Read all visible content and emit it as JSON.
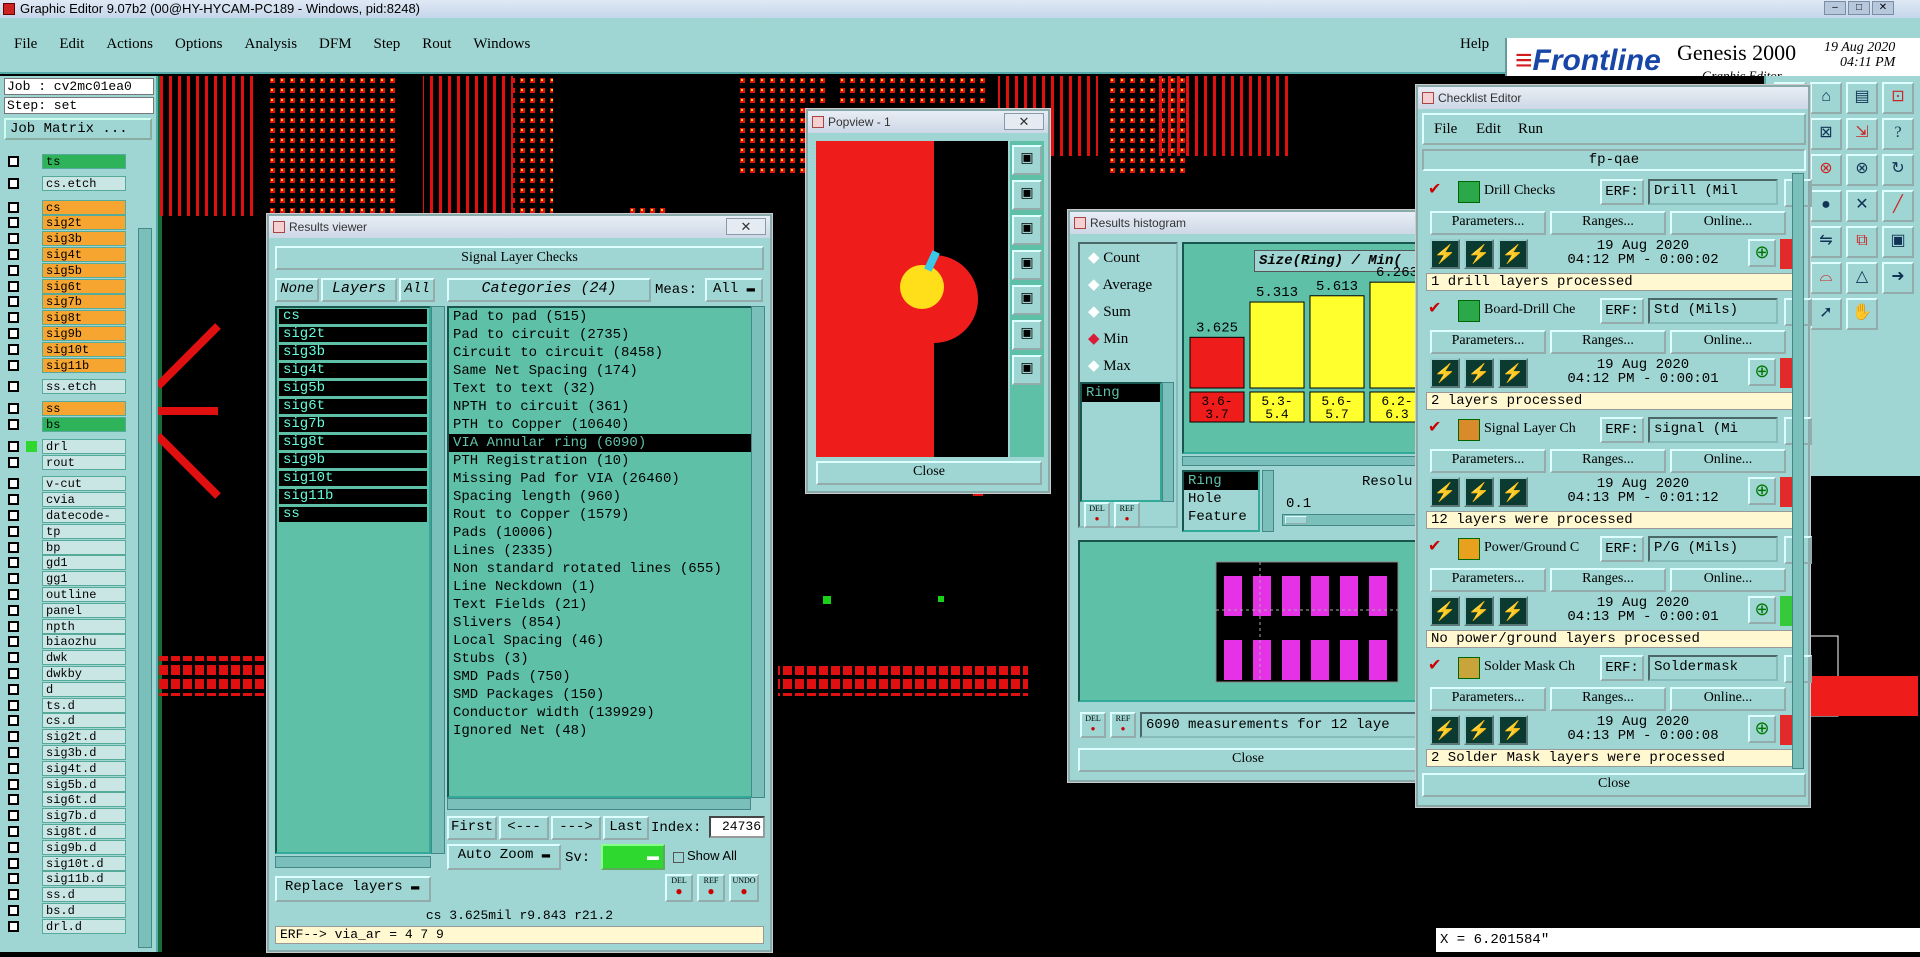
{
  "window_title": "Graphic Editor 9.07b2 (00@HY-HYCAM-PC189 - Windows, pid:8248)",
  "menu": [
    "File",
    "Edit",
    "Actions",
    "Options",
    "Analysis",
    "DFM",
    "Step",
    "Rout",
    "Windows"
  ],
  "help": "Help",
  "brand": {
    "logo": "Frontline",
    "product": "Genesis 2000",
    "subtitle": "Graphic Editor",
    "date": "19 Aug 2020",
    "time": "04:11 PM"
  },
  "left_panel": {
    "job": "Job : cv2mc01ea0",
    "step": "Step: set",
    "job_matrix": "Job Matrix ...",
    "layers": [
      {
        "name": "ts",
        "color": "#2fb35a"
      },
      {
        "name": "cs.etch",
        "color": "#c9e6e4"
      },
      {
        "name": "cs",
        "color": "#f6a531"
      },
      {
        "name": "sig2t",
        "color": "#f6a531"
      },
      {
        "name": "sig3b",
        "color": "#f6a531"
      },
      {
        "name": "sig4t",
        "color": "#f6a531"
      },
      {
        "name": "sig5b",
        "color": "#f6a531"
      },
      {
        "name": "sig6t",
        "color": "#f6a531"
      },
      {
        "name": "sig7b",
        "color": "#f6a531"
      },
      {
        "name": "sig8t",
        "color": "#f6a531"
      },
      {
        "name": "sig9b",
        "color": "#f6a531"
      },
      {
        "name": "sig10t",
        "color": "#f6a531"
      },
      {
        "name": "sig11b",
        "color": "#f6a531"
      },
      {
        "name": "ss.etch",
        "color": "#c9e6e4"
      },
      {
        "name": "ss",
        "color": "#f6a531"
      },
      {
        "name": "bs",
        "color": "#2fb35a"
      },
      {
        "name": "drl",
        "color": "#c9e6e4"
      },
      {
        "name": "rout",
        "color": "#c9e6e4"
      },
      {
        "name": "v-cut",
        "color": "#c9e6e4"
      },
      {
        "name": "cvia",
        "color": "#c9e6e4"
      },
      {
        "name": "datecode-ss",
        "color": "#c9e6e4"
      },
      {
        "name": "tp",
        "color": "#c9e6e4"
      },
      {
        "name": "bp",
        "color": "#c9e6e4"
      },
      {
        "name": "gd1",
        "color": "#c9e6e4"
      },
      {
        "name": "gg1",
        "color": "#c9e6e4"
      },
      {
        "name": "outline",
        "color": "#c9e6e4"
      },
      {
        "name": "panel",
        "color": "#c9e6e4"
      },
      {
        "name": "npth",
        "color": "#c9e6e4"
      },
      {
        "name": "biaozhu",
        "color": "#c9e6e4"
      },
      {
        "name": "dwk",
        "color": "#c9e6e4"
      },
      {
        "name": "dwkby",
        "color": "#c9e6e4"
      },
      {
        "name": "d",
        "color": "#c9e6e4"
      },
      {
        "name": "ts.d",
        "color": "#c9e6e4"
      },
      {
        "name": "cs.d",
        "color": "#c9e6e4"
      },
      {
        "name": "sig2t.d",
        "color": "#c9e6e4"
      },
      {
        "name": "sig3b.d",
        "color": "#c9e6e4"
      },
      {
        "name": "sig4t.d",
        "color": "#c9e6e4"
      },
      {
        "name": "sig5b.d",
        "color": "#c9e6e4"
      },
      {
        "name": "sig6t.d",
        "color": "#c9e6e4"
      },
      {
        "name": "sig7b.d",
        "color": "#c9e6e4"
      },
      {
        "name": "sig8t.d",
        "color": "#c9e6e4"
      },
      {
        "name": "sig9b.d",
        "color": "#c9e6e4"
      },
      {
        "name": "sig10t.d",
        "color": "#c9e6e4"
      },
      {
        "name": "sig11b.d",
        "color": "#c9e6e4"
      },
      {
        "name": "ss.d",
        "color": "#c9e6e4"
      },
      {
        "name": "bs.d",
        "color": "#c9e6e4"
      },
      {
        "name": "drl.d",
        "color": "#c9e6e4"
      }
    ]
  },
  "results_viewer": {
    "title": "Results viewer",
    "header": "Signal Layer Checks",
    "none": "None",
    "layers_label": "Layers",
    "all": "All",
    "categories_label": "Categories (24)",
    "meas_label": "Meas:",
    "meas_value": "All",
    "layers": [
      "cs",
      "sig2t",
      "sig3b",
      "sig4t",
      "sig5b",
      "sig6t",
      "sig7b",
      "sig8t",
      "sig9b",
      "sig10t",
      "sig11b",
      "ss"
    ],
    "categories": [
      "Pad to pad (515)",
      "Pad to circuit (2735)",
      "Circuit to circuit (8458)",
      "Same Net Spacing (174)",
      "Text to text (32)",
      "NPTH to circuit (361)",
      "PTH to Copper (10640)",
      "VIA Annular ring (6090)",
      "PTH Registration (10)",
      "Missing Pad for VIA (26460)",
      "Spacing length (960)",
      "Rout to Copper (1579)",
      "Pads (10006)",
      "Lines (2335)",
      "Non standard rotated lines (655)",
      "Line Neckdown (1)",
      "Text Fields (21)",
      "Slivers (854)",
      "Local Spacing (46)",
      "Stubs (3)",
      "SMD Pads (750)",
      "SMD Packages (150)",
      "Conductor width (139929)",
      "Ignored Net (48)"
    ],
    "selected_index": 7,
    "first": "First",
    "prev": "<---",
    "next": "--->",
    "last": "Last",
    "index_label": "Index:",
    "index_value": "24736",
    "auto_zoom": "Auto Zoom",
    "sv_label": "Sv:",
    "show_all": "Show All",
    "replace_layers": "Replace layers",
    "del": "DEL",
    "ref": "REF",
    "undo": "UNDO",
    "status": "cs  3.625mil  r9.843  r21.2",
    "erf_line": "ERF--> via_ar = 4 7 9"
  },
  "popview": {
    "title": "Popview - 1",
    "close": "Close"
  },
  "histogram": {
    "title": "Results histogram",
    "options": [
      "Count",
      "Average",
      "Sum",
      "Min",
      "Max"
    ],
    "selected_option": "Min",
    "size_label": "Size(Ring) / Min(",
    "ring": "Ring",
    "kinds": [
      "Ring",
      "Hole",
      "Feature"
    ],
    "resolution_label": "Resolu",
    "resolution_value": "0.1",
    "bars": [
      {
        "value": "3.625",
        "range": "3.6-\n3.7",
        "color": "#ef1c1c",
        "val": 3.625
      },
      {
        "value": "5.313",
        "range": "5.3-\n5.4",
        "color": "#ffff2e",
        "val": 5.313
      },
      {
        "value": "5.613",
        "range": "5.6-\n5.7",
        "color": "#ffff2e",
        "val": 5.613
      },
      {
        "value": "6.263",
        "range": "6.2-\n6.3",
        "color": "#ffff2e",
        "val": 6.263
      }
    ],
    "del": "DEL",
    "ref": "REF",
    "measurements": "6090 measurements for 12 laye",
    "close": "Close"
  },
  "checklist": {
    "title": "Checklist Editor",
    "menu": [
      "File",
      "Edit",
      "Run"
    ],
    "name": "fp-qae",
    "erf_label": "ERF:",
    "parameters": "Parameters...",
    "ranges": "Ranges...",
    "online": "Online...",
    "close": "Close",
    "items": [
      {
        "name": "Drill Checks",
        "erf": "Drill (Mil",
        "date": "19 Aug 2020",
        "time": "04:12 PM - 0:00:02",
        "status": "1 drill layers processed",
        "flag": "#e32a2a",
        "icon": "#2aa84a"
      },
      {
        "name": "Board-Drill Che",
        "erf": "Std (Mils)",
        "date": "19 Aug 2020",
        "time": "04:12 PM - 0:00:01",
        "status": "2 layers processed",
        "flag": "#e32a2a",
        "icon": "#2aa84a"
      },
      {
        "name": "Signal Layer Ch",
        "erf": "signal (Mi",
        "date": "19 Aug 2020",
        "time": "04:13 PM - 0:01:12",
        "status": "12 layers were processed",
        "flag": "#e32a2a",
        "icon": "#d98a2a"
      },
      {
        "name": "Power/Ground C",
        "erf": "P/G (Mils)",
        "date": "19 Aug 2020",
        "time": "04:13 PM - 0:00:01",
        "status": "No power/ground layers processed",
        "flag": "#36c93a",
        "icon": "#e8a11f"
      },
      {
        "name": "Solder Mask Ch",
        "erf": "Soldermask",
        "date": "19 Aug 2020",
        "time": "04:13 PM - 0:00:08",
        "status": "2 Solder Mask layers were processed",
        "flag": "#e32a2a",
        "icon": "#c9a43a"
      }
    ]
  },
  "coord_readout": "X = 6.201584\""
}
